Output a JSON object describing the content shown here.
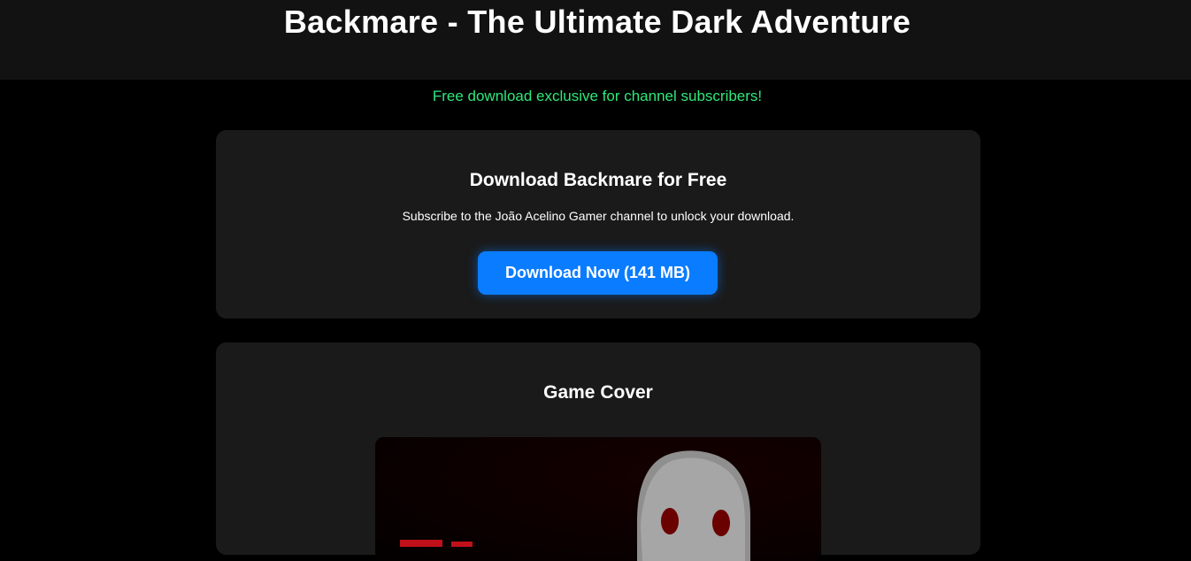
{
  "header": {
    "title": "Backmare - The Ultimate Dark Adventure"
  },
  "promo_text": "Free download exclusive for channel subscribers!",
  "download_section": {
    "heading": "Download Backmare for Free",
    "description": "Subscribe to the João Acelino Gamer channel to unlock your download.",
    "button_label": "Download Now (141 MB)"
  },
  "cover_section": {
    "heading": "Game Cover",
    "image_alt": "Backmare game cover"
  },
  "colors": {
    "page_background": "#000000",
    "header_background": "#121212",
    "card_background": "#1a1a1a",
    "promo_green": "#2ee87a",
    "button_blue": "#0a7cff",
    "cover_red": "#c0101a"
  }
}
